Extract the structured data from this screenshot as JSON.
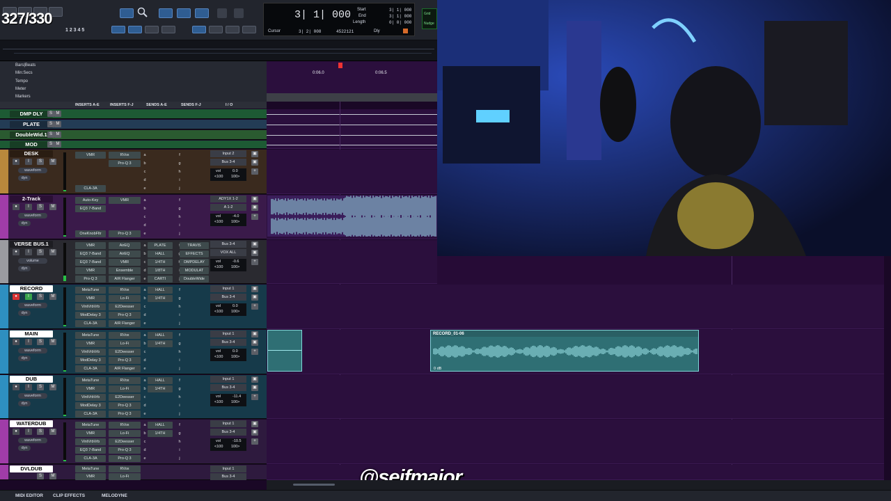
{
  "colors": {
    "accent": "#2f5d92",
    "track_lane": "#2b0f3d",
    "audio_clip": "#2f6f74",
    "waveform": "#9ee8ec",
    "record_btn": "#d63232"
  },
  "overlay": {
    "fps_counter": "327/330",
    "watermark": "@seifmajor"
  },
  "counter": {
    "main": "3| 1| 000",
    "cursor_label": "Cursor",
    "cursor_value": "3| 2| 008",
    "sample_value": "4522121",
    "start_label": "Start",
    "start_value": "3| 1| 000",
    "end_label": "End",
    "end_value": "3| 1| 000",
    "length_label": "Length",
    "length_value": "0| 0| 000",
    "dly_label": "Dly",
    "nudge_label": "Grid",
    "nudge_label2": "Nudge"
  },
  "rulers": [
    {
      "label": "Bars|Beats"
    },
    {
      "label": "Min:Secs"
    },
    {
      "label": "Tempo"
    },
    {
      "label": "Meter"
    },
    {
      "label": "Markers"
    }
  ],
  "ruler_ticks": {
    "t1": "0:06.0",
    "t2": "0:06.5"
  },
  "columns": {
    "inserts_ae": "INSERTS A-E",
    "inserts_fj": "INSERTS F-J",
    "sends_ae": "SENDS A-E",
    "sends_fj": "SENDS F-J",
    "io": "I / O"
  },
  "aux_tracks": [
    {
      "name": "DMP DLY"
    },
    {
      "name": "PLATE"
    },
    {
      "name": "DoubleWid.1"
    },
    {
      "name": "MOD"
    }
  ],
  "tracks": [
    {
      "name": "DESK",
      "mode": "waveform",
      "sub": "dyn",
      "ins1": [
        "VMR",
        "",
        "",
        "",
        "CLA-3A"
      ],
      "ins2": [
        "RVox",
        "Pro-Q 3",
        "",
        "",
        ""
      ],
      "io_in": "Input 2",
      "io_out": "Bus 3-4",
      "vol": "0.0",
      "pan_l": "<100",
      "pan_r": "100>"
    },
    {
      "name": "2-Track",
      "mode": "waveform",
      "sub": "dyn",
      "ins1": [
        "Auto-Key",
        "EQ3 7-Band",
        "",
        "",
        "OneKnobFltr"
      ],
      "ins2": [
        "VMR",
        "",
        "",
        "",
        "Pro-Q 3"
      ],
      "io_in": "ADY1X 1-2",
      "io_out": "A 1-2",
      "vol": "-4.0",
      "pan_l": "<100",
      "pan_r": "100>"
    },
    {
      "name": "VERSE BUS.1",
      "mode": "volume",
      "sub": "dyn",
      "ins1": [
        "VMR",
        "EQ3 7-Band",
        "EQ3 7-Band",
        "VMR",
        "Pro-Q 3"
      ],
      "ins2": [
        "AirEQ",
        "AirEQ",
        "VMR",
        "Ensemble",
        "AIR Flanger"
      ],
      "sends1": [
        "PLATE",
        "HALL",
        "1/4TH",
        "1/8TH",
        "CARTI"
      ],
      "sends2": [
        "TRAVIS",
        "EFFECTS",
        "DMPDELAY",
        "MODULAT",
        "DoubleWide"
      ],
      "io_in": "Bus 3-4",
      "io_out": "VOX ALL",
      "vol": "-0.6",
      "pan_l": "<100",
      "pan_r": "100>"
    },
    {
      "name": "RECORD",
      "mode": "waveform",
      "sub": "dyn",
      "ins1": [
        "MetaTune",
        "VMR",
        "VintVrbVrb",
        "ModDelay 3",
        "CLA-3A"
      ],
      "ins2": [
        "RVox",
        "Lo-Fi",
        "E2Deesser",
        "Pro-Q 3",
        "AIR Flanger"
      ],
      "sends1": [
        "HALL",
        "1/4TH",
        "",
        "",
        ""
      ],
      "io_in": "Input 1",
      "io_out": "Bus 3-4",
      "vol": "0.0",
      "pan_l": "<100",
      "pan_r": "100>"
    },
    {
      "name": "MAIN",
      "mode": "waveform",
      "sub": "dyn",
      "ins1": [
        "MetaTune",
        "VMR",
        "VintVrbVrb",
        "ModDelay 3",
        "CLA-3A"
      ],
      "ins2": [
        "RVox",
        "Lo-Fi",
        "E2Deesser",
        "Pro-Q 3",
        "AIR Flanger"
      ],
      "sends1": [
        "HALL",
        "1/4TH",
        "",
        "",
        ""
      ],
      "io_in": "Input 1",
      "io_out": "Bus 3-4",
      "vol": "0.0",
      "pan_l": "<100",
      "pan_r": "100>"
    },
    {
      "name": "DUB",
      "mode": "waveform",
      "sub": "dyn",
      "ins1": [
        "MetaTune",
        "VMR",
        "VintVrbVrb",
        "ModDelay 3",
        "CLA-3A"
      ],
      "ins2": [
        "RVox",
        "Lo-Fi",
        "E2Deesser",
        "Pro-Q 3",
        "Pro-Q 3"
      ],
      "sends1": [
        "HALL",
        "1/4TH",
        "",
        "",
        ""
      ],
      "io_in": "Input 1",
      "io_out": "Bus 3-4",
      "vol": "-11.4",
      "pan_l": "<100",
      "pan_r": "100>"
    },
    {
      "name": "WATERDUB",
      "mode": "waveform",
      "sub": "dyn",
      "ins1": [
        "MetaTune",
        "VMR",
        "VintVrbVrb",
        "EQ3 7-Band",
        "CLA-3A"
      ],
      "ins2": [
        "RVox",
        "Lo-Fi",
        "E2Deesser",
        "Pro-Q 3",
        "Pro-Q 3"
      ],
      "sends1": [
        "HALL",
        "1/4TH",
        "",
        "",
        ""
      ],
      "io_in": "Input 1",
      "io_out": "Bus 3-4",
      "vol": "-10.5",
      "pan_l": "<100",
      "pan_r": "100>"
    },
    {
      "name": "DVLDUB",
      "mode": "waveform",
      "sub": "dyn",
      "ins1": [
        "MetaTune",
        "VMR",
        "",
        "",
        ""
      ],
      "ins2": [
        "RVox",
        "Lo-Fi",
        "",
        "",
        ""
      ],
      "sends1": [
        "",
        "",
        "",
        "",
        ""
      ],
      "io_in": "Input 1",
      "io_out": "Bus 3-4",
      "vol": "",
      "pan_l": "",
      "pan_r": ""
    }
  ],
  "clip": {
    "name": "RECORD_01-06",
    "gain": "0 dB"
  },
  "bottom": {
    "midi_editor": "MIDI EDITOR",
    "clip_effects": "CLIP EFFECTS",
    "melodyne": "MELODYNE"
  }
}
